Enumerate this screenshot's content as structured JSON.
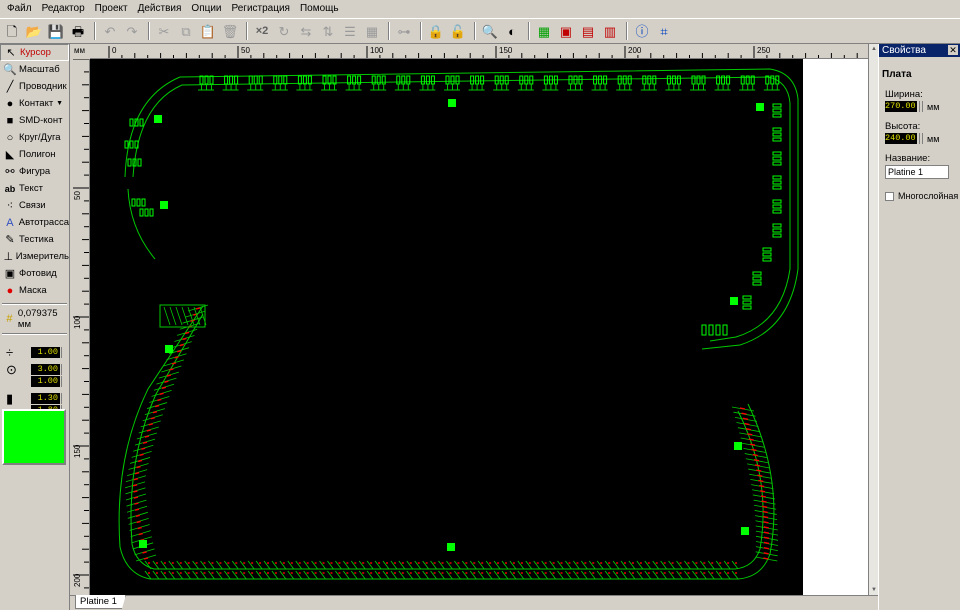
{
  "menu": [
    "Файл",
    "Редактор",
    "Проект",
    "Действия",
    "Опции",
    "Регистрация",
    "Помощь"
  ],
  "toolbar": {
    "multiplier": "×2"
  },
  "tools": [
    {
      "id": "cursor",
      "label": "Курсор",
      "icon": "cursor-icon",
      "active": true
    },
    {
      "id": "zoom",
      "label": "Масштаб",
      "icon": "magnifier-icon"
    },
    {
      "id": "track",
      "label": "Проводник",
      "icon": "track-icon"
    },
    {
      "id": "pad",
      "label": "Контакт",
      "icon": "pad-icon",
      "dropdown": true
    },
    {
      "id": "smd",
      "label": "SMD-конт",
      "icon": "smd-pad-icon"
    },
    {
      "id": "circle",
      "label": "Круг/Дуга",
      "icon": "circle-icon"
    },
    {
      "id": "polygon",
      "label": "Полигон",
      "icon": "polygon-icon"
    },
    {
      "id": "shape",
      "label": "Фигура",
      "icon": "shape-icon"
    },
    {
      "id": "text",
      "label": "Текст",
      "icon": "text-icon"
    },
    {
      "id": "connections",
      "label": "Связи",
      "icon": "connections-icon"
    },
    {
      "id": "autoroute",
      "label": "Автотрасса",
      "icon": "autoroute-icon"
    },
    {
      "id": "test",
      "label": "Тестика",
      "icon": "test-icon"
    },
    {
      "id": "measure",
      "label": "Измеритель",
      "icon": "ruler-icon"
    },
    {
      "id": "photo",
      "label": "Фотовид",
      "icon": "camera-icon"
    },
    {
      "id": "mask",
      "label": "Маска",
      "icon": "mask-icon"
    }
  ],
  "grid": {
    "value": "0,079375 мм",
    "icon": "grid-icon"
  },
  "params": {
    "track_width": "1.00",
    "pad_outer": "3.00",
    "pad_inner": "1.00",
    "smd_width": "1.30",
    "smd_height": "1.80"
  },
  "layer_color": "#00ff00",
  "rulers": {
    "unit": "мм",
    "top": [
      {
        "v": "0"
      },
      {
        "v": "50"
      },
      {
        "v": "100"
      },
      {
        "v": "150"
      },
      {
        "v": "200"
      },
      {
        "v": "250"
      }
    ],
    "left": [
      {
        "v": "50"
      },
      {
        "v": "100"
      },
      {
        "v": "150"
      },
      {
        "v": "200"
      }
    ]
  },
  "tab": {
    "label": "Platine 1"
  },
  "properties": {
    "title": "Свойства",
    "section": "Плата",
    "width_label": "Ширина:",
    "width_value": "270.00",
    "height_label": "Высота:",
    "height_value": "240.00",
    "unit": "мм",
    "name_label": "Название:",
    "name_value": "Platine 1",
    "multilayer_label": "Многослойная",
    "multilayer_checked": false
  },
  "colors": {
    "board": "#000000",
    "trace": "#00c800",
    "pad": "#00ff00",
    "mark": "#ff0000",
    "title_bar": "#0a246a"
  }
}
